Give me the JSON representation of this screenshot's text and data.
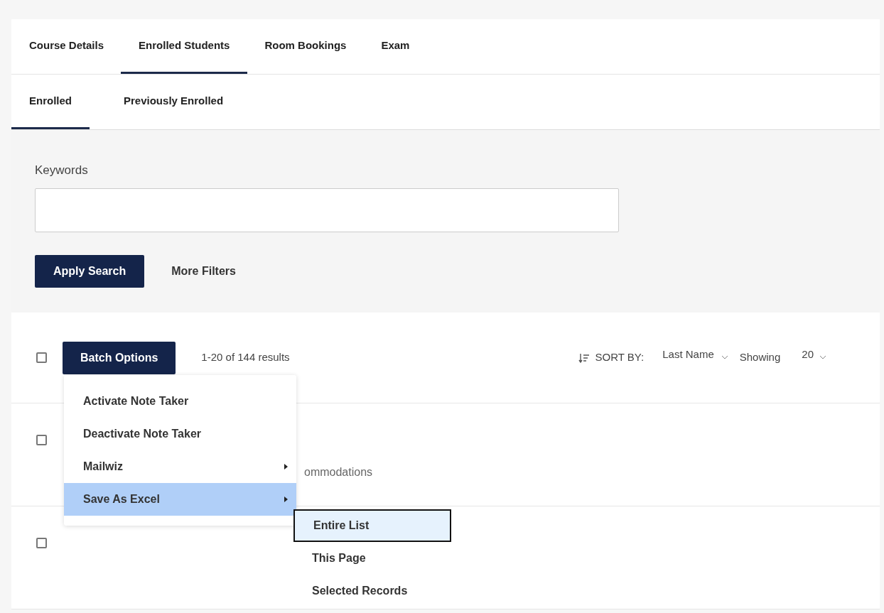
{
  "tabs": [
    {
      "label": "Course Details",
      "selected": false
    },
    {
      "label": "Enrolled Students",
      "selected": true
    },
    {
      "label": "Room Bookings",
      "selected": false
    },
    {
      "label": "Exam",
      "selected": false
    }
  ],
  "subtabs": [
    {
      "label": "Enrolled",
      "selected": true
    },
    {
      "label": "Previously Enrolled",
      "selected": false
    }
  ],
  "search": {
    "label": "Keywords",
    "apply_button": "Apply Search",
    "more_filters": "More Filters"
  },
  "results_bar": {
    "select_all_checked": false,
    "batch_button": "Batch Options",
    "count": "1-20 of 144 results",
    "sort_label": "SORT BY:",
    "sort_value": "Last Name",
    "showing_label": "Showing",
    "showing_value": "20"
  },
  "batch_menu": [
    {
      "label": "Activate Note Taker",
      "submenu": false,
      "selected": false
    },
    {
      "label": "Deactivate Note Taker",
      "submenu": false,
      "selected": false
    },
    {
      "label": "Mailwiz",
      "submenu": true,
      "selected": false
    },
    {
      "label": "Save As Excel",
      "submenu": true,
      "selected": true
    }
  ],
  "submenu": [
    {
      "label": "Entire List",
      "selected": true
    },
    {
      "label": "This Page",
      "selected": false
    },
    {
      "label": "Selected Records",
      "selected": false
    }
  ],
  "rows": [
    {
      "checked": false,
      "text": "ommodations"
    },
    {
      "checked": false
    }
  ]
}
